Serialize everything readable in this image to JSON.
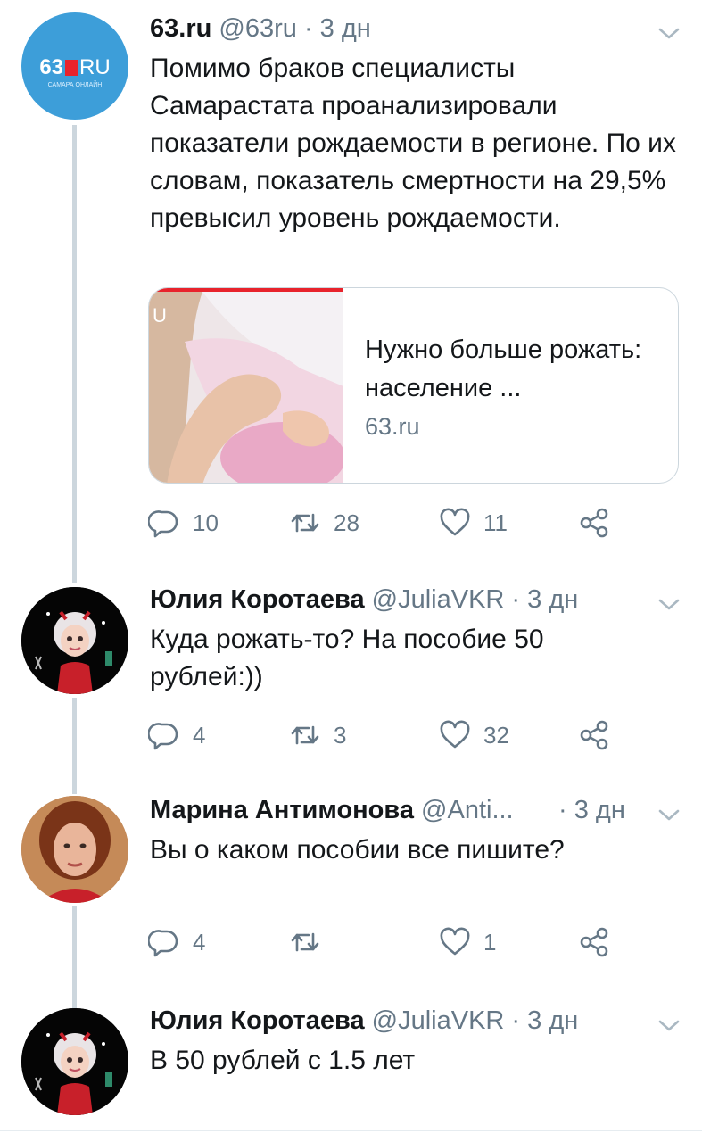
{
  "tweets": [
    {
      "name": "63.ru",
      "handle": "@63ru",
      "dot": "·",
      "time": "3 дн",
      "text": "Помимо браков специалисты Самарастата проанализировали показатели рождаемости в регионе. По их словам, показатель смертности на 29,5% превысил уровень рождаемости.",
      "card": {
        "title": "Нужно больше рожать: население ...",
        "domain": "63.ru"
      },
      "replies": "10",
      "retweets": "28",
      "likes": "11",
      "avatar_logo": {
        "num": "63",
        "ru": "RU",
        "sub": "САМАРА ОНЛАЙН"
      }
    },
    {
      "name": "Юлия Коротаева",
      "handle": "@JuliaVKR",
      "dot": "·",
      "time": "3 дн",
      "text": "Куда рожать-то? На пособие 50 рублей:))",
      "replies": "4",
      "retweets": "3",
      "likes": "32"
    },
    {
      "name": "Марина Антимонова",
      "handle": "@Anti...",
      "dot": "·",
      "time": "3 дн",
      "text": "Вы о каком пособии все пишите?",
      "replies": "4",
      "retweets": "",
      "likes": "1"
    },
    {
      "name": "Юлия Коротаева",
      "handle": "@JuliaVKR",
      "dot": "·",
      "time": "3 дн",
      "text": "В 50 рублей с 1.5 лет"
    }
  ],
  "icons": {
    "reply": "reply-icon",
    "retweet": "retweet-icon",
    "like": "heart-icon",
    "share": "share-icon",
    "more": "chevron-down-icon"
  },
  "colors": {
    "gray": "#657786",
    "brand_red": "#e8232c",
    "avatar_blue": "#3d9ed9"
  }
}
